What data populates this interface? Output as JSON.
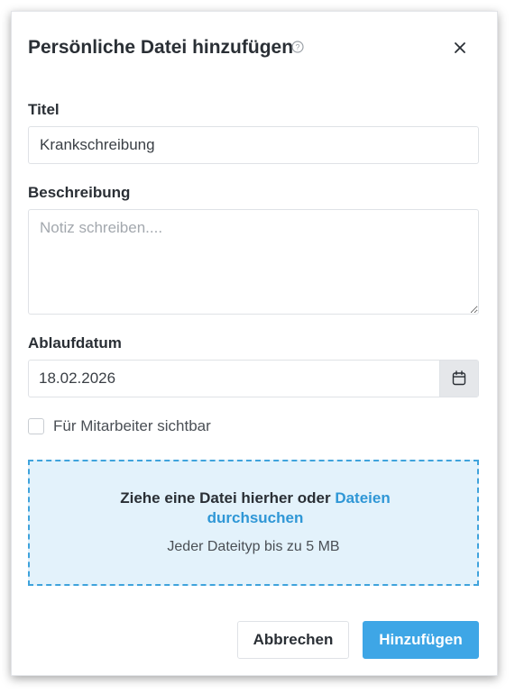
{
  "dialog": {
    "title": "Persönliche Datei hinzufügen",
    "help_icon": "question-circle-icon",
    "close_icon": "close-icon"
  },
  "form": {
    "title_label": "Titel",
    "title_value": "Krankschreibung",
    "description_label": "Beschreibung",
    "description_placeholder": "Notiz schreiben....",
    "expiry_label": "Ablaufdatum",
    "expiry_value": "18.02.2026",
    "calendar_icon": "calendar-icon",
    "visible_checkbox_label": "Für Mitarbeiter sichtbar",
    "visible_checked": false
  },
  "dropzone": {
    "text": "Ziehe eine Datei hierher oder",
    "link": "Dateien durchsuchen",
    "hint": "Jeder Dateityp bis zu 5 MB"
  },
  "footer": {
    "cancel_label": "Abbrechen",
    "submit_label": "Hinzufügen"
  },
  "colors": {
    "accent": "#3ea6e6",
    "link": "#2f97d6",
    "dropzone_bg": "#e3f2fb",
    "dropzone_border": "#3fa3dc"
  }
}
